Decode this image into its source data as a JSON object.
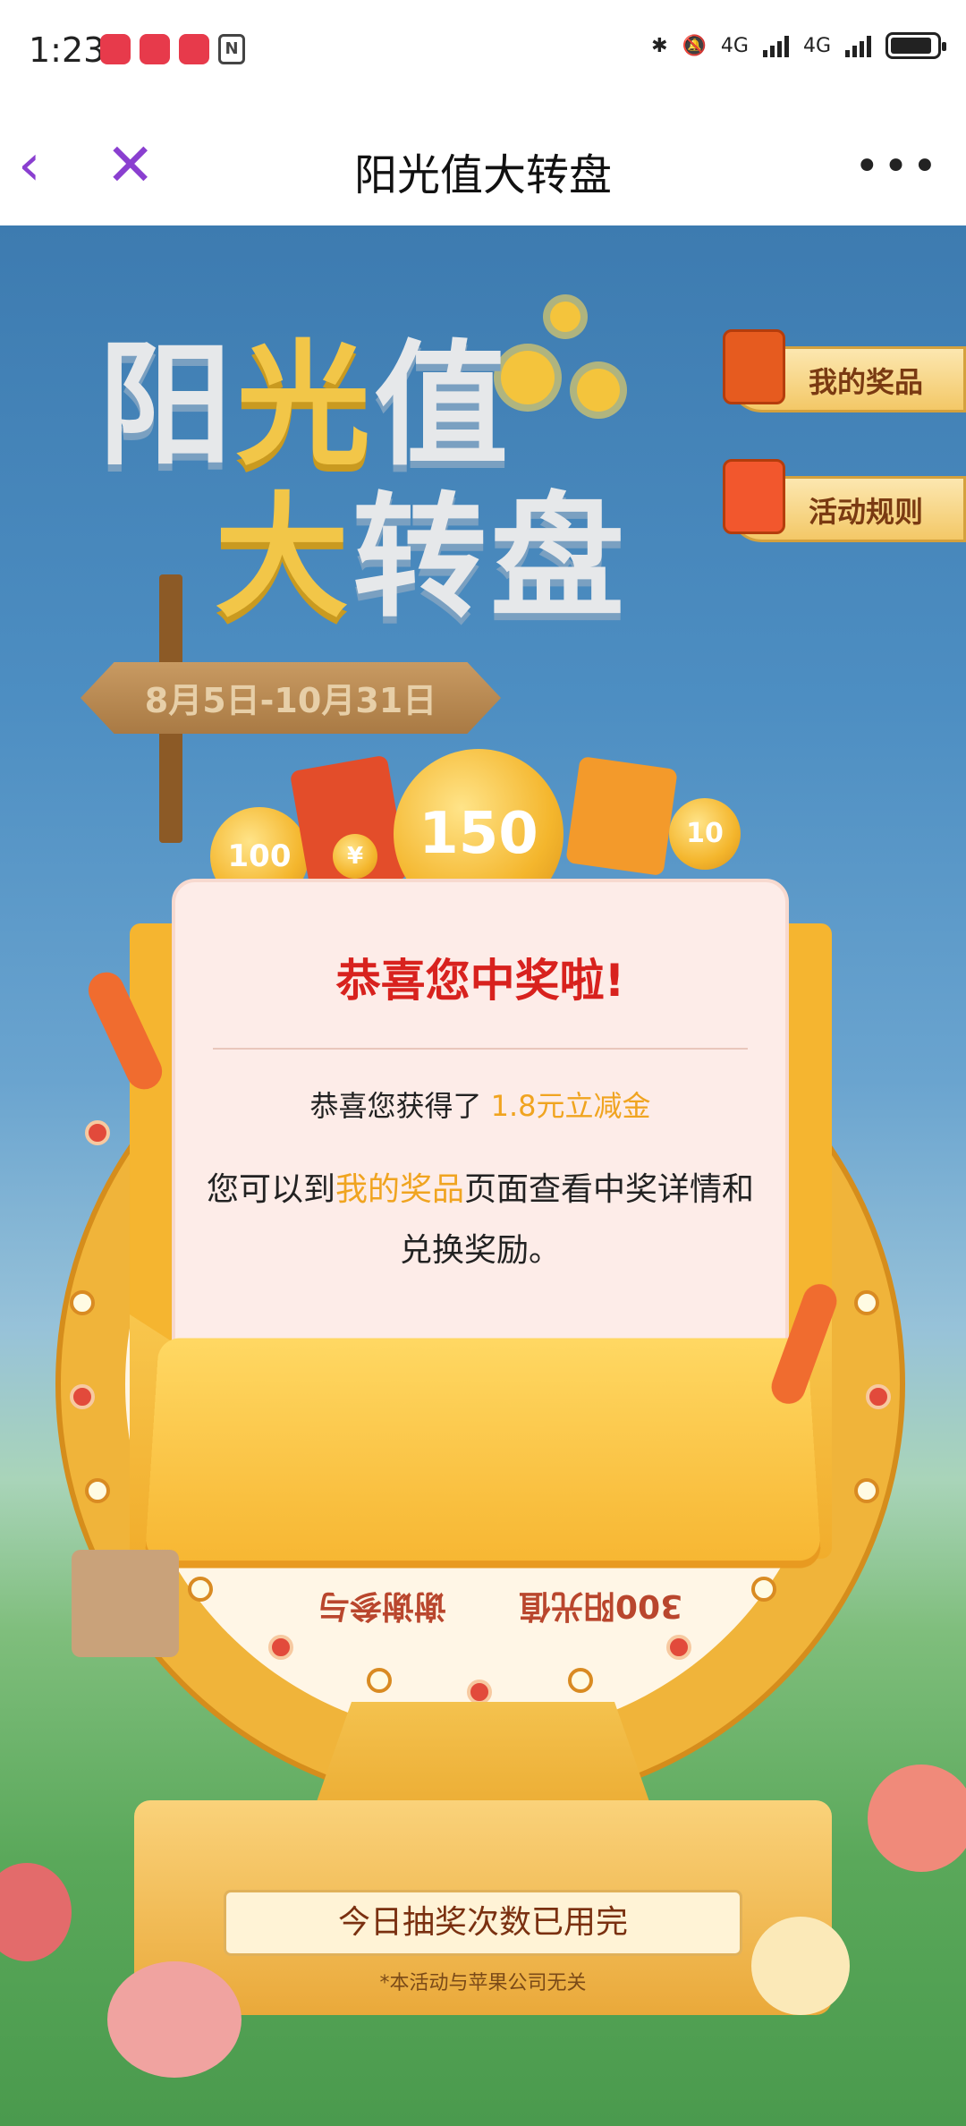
{
  "status_bar": {
    "time": "1:23",
    "app_icons": [
      "huawei-app-icon",
      "huawei-app-icon",
      "huawei-app-icon"
    ],
    "nfc_label": "N",
    "network_1": "4G",
    "network_2": "4G"
  },
  "nav": {
    "title": "阳光值大转盘",
    "back_icon": "chevron-left-icon",
    "close_icon": "close-icon",
    "more_icon": "more-horizontal-icon"
  },
  "hero": {
    "title_line1_a": "阳",
    "title_line1_b": "光",
    "title_line1_c": "值",
    "title_line2_a": "大",
    "title_line2_b": "转盘",
    "date_range": "8月5日-10月31日"
  },
  "side_buttons": {
    "my_prizes": "我的奖品",
    "rules": "活动规则"
  },
  "coins": {
    "coin_small": "100",
    "coin_big": "150",
    "coin_tilted": "10",
    "red_packet_symbol": "¥"
  },
  "dialog": {
    "title": "恭喜您中奖啦!",
    "line1_prefix": "恭喜您获得了 ",
    "line1_prize": "1.8元立减金",
    "line2_prefix": "您可以到",
    "line2_link": "我的奖品",
    "line2_suffix": "页面查看中奖详情和兑换奖励。"
  },
  "wheel": {
    "segment_left": "谢谢参与",
    "segment_right": "300阳光值"
  },
  "footer": {
    "draw_status": "今日抽奖次数已用完",
    "disclaimer": "*本活动与苹果公司无关"
  }
}
